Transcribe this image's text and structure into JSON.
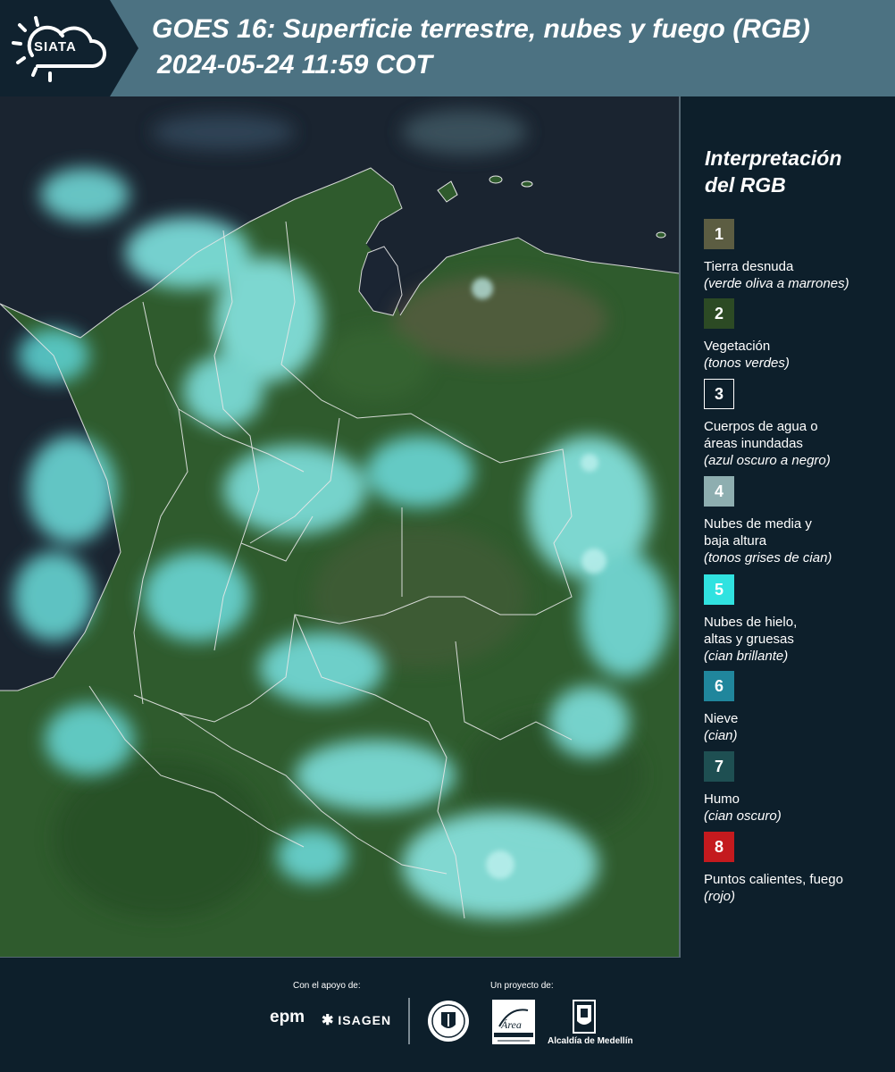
{
  "header": {
    "logo_text": "SIATA",
    "title_line1": "GOES 16: Superficie terrestre, nubes y fuego (RGB)",
    "title_line2": "2024-05-24 11:59 COT"
  },
  "legend": {
    "title": "Interpretación del RGB",
    "items": [
      {
        "number": "1",
        "label": "Tierra desnuda",
        "description": "(verde oliva a marrones)",
        "color": "#5c5d42"
      },
      {
        "number": "2",
        "label": "Vegetación",
        "description": "(tonos verdes)",
        "color": "#2c4a24"
      },
      {
        "number": "3",
        "label": "Cuerpos de agua o\náreas inundadas",
        "description": "(azul oscuro a negro)",
        "color": "#0d1f2b"
      },
      {
        "number": "4",
        "label": "Nubes de media y\nbaja altura",
        "description": "(tonos grises de cian)",
        "color": "#8eaeb0"
      },
      {
        "number": "5",
        "label": "Nubes de hielo,\naltas y gruesas",
        "description": "(cian brillante)",
        "color": "#30e2e0"
      },
      {
        "number": "6",
        "label": "Nieve",
        "description": "(cian)",
        "color": "#20869c"
      },
      {
        "number": "7",
        "label": "Humo",
        "description": "(cian oscuro)",
        "color": "#1e4f52"
      },
      {
        "number": "8",
        "label": "Puntos calientes, fuego",
        "description": "(rojo)",
        "color": "#c41a1e"
      }
    ]
  },
  "footer": {
    "support_caption": "Con el apoyo de:",
    "project_caption": "Un proyecto de:",
    "epm": "epm",
    "isagen": "ISAGEN",
    "area_metropolitana": "Área METROPOLITANA Valle de Aburrá",
    "alcaldia": "Alcaldía de Medellín"
  },
  "colors": {
    "header_bg": "#4c7282",
    "logo_bg": "#10222f",
    "page_bg": "#0d1f2b",
    "ocean": "#1a2430",
    "land": "#2e5a2c",
    "cloud": "#7fe3e0",
    "border_lines": "#e8e8e8"
  }
}
